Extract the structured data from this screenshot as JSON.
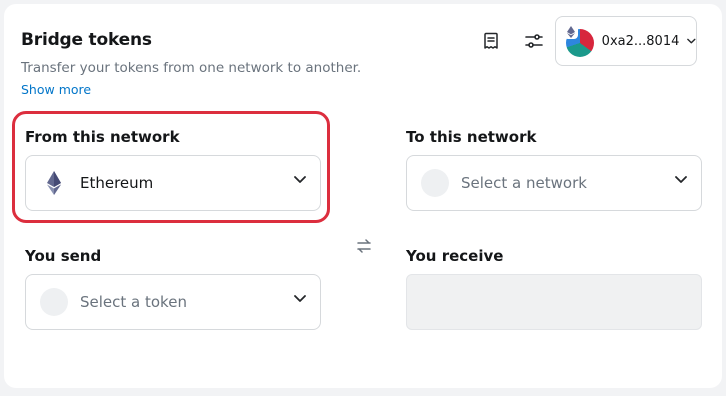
{
  "header": {
    "title": "Bridge tokens",
    "subtitle": "Transfer your tokens from one network to another.",
    "show_more": "Show more"
  },
  "account": {
    "address": "0xa2...8014",
    "badge_icon": "ethereum-icon"
  },
  "toolbar": {
    "activity_icon": "receipt-icon",
    "settings_icon": "sliders-icon"
  },
  "from_network": {
    "label": "From this network",
    "value": "Ethereum",
    "icon": "ethereum-icon"
  },
  "to_network": {
    "label": "To this network",
    "placeholder": "Select a network"
  },
  "send": {
    "label": "You send",
    "placeholder": "Select a token"
  },
  "receive": {
    "label": "You receive"
  },
  "colors": {
    "accent_link": "#0376c9",
    "highlight_border": "#dc2e3e",
    "muted_text": "#6a737d",
    "border": "#d6d9dc"
  }
}
